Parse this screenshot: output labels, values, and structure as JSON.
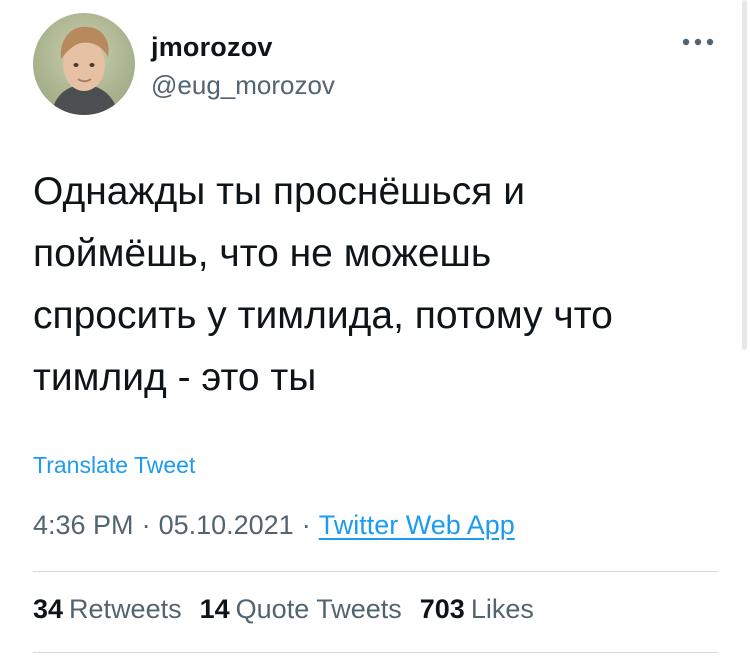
{
  "author": {
    "display_name": "jmorozov",
    "handle": "@eug_morozov"
  },
  "more_icon": "more-dots-icon",
  "tweet": {
    "text": "Однажды ты проснёшься и\nпоймёшь, что не можешь\nспросить у тимлида, потому что\nтимлид - это ты",
    "translate_label": "Translate Tweet"
  },
  "meta": {
    "time": "4:36 PM",
    "separator": "·",
    "date": "05.10.2021",
    "source": "Twitter Web App"
  },
  "stats": {
    "retweets_count": "34",
    "retweets_label": "Retweets",
    "quotes_count": "14",
    "quotes_label": "Quote Tweets",
    "likes_count": "703",
    "likes_label": "Likes"
  },
  "colors": {
    "text": "#0f1419",
    "secondary": "#536471",
    "link": "#1d9bf0",
    "divider": "#cfd9de"
  }
}
